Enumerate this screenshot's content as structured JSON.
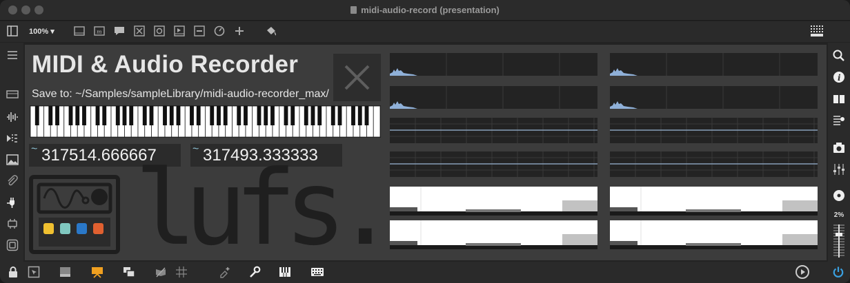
{
  "window": {
    "title": "midi-audio-record (presentation)"
  },
  "toolbar": {
    "zoom": "100%",
    "zoom_arrow": "▾"
  },
  "patch": {
    "title": "MIDI & Audio Recorder",
    "save_path": "Save to: ~/Samples/sampleLibrary/midi-audio-recorder_max/",
    "number_left": "317514.666667",
    "number_right": "317493.333333",
    "number_prefix": "~",
    "logo_text": "lufs."
  },
  "right_sidebar": {
    "cpu_label": "2%"
  },
  "colors": {
    "accent_orange": "#f0a020",
    "power_blue": "#3aa0e0",
    "scope_line": "#9ab8d8",
    "logo_yellow": "#f0c030",
    "logo_teal": "#80c8c0",
    "logo_blue": "#2a78c8",
    "logo_red": "#e06030"
  },
  "icons": {
    "toolbar": [
      "sidebar-toggle-icon",
      "panel-icon",
      "message-icon",
      "comment-icon",
      "toggle-icon",
      "button-icon",
      "play-icon",
      "slider-icon",
      "dial-icon",
      "add-icon",
      "paint-bucket-icon",
      "grid-icon"
    ],
    "left_sidebar": [
      "menu-icon",
      "device-icon",
      "audio-icon",
      "step-icon",
      "image-icon",
      "clip-icon",
      "plug-icon",
      "chip-icon",
      "frame-icon"
    ],
    "right_sidebar": [
      "search-icon",
      "info-icon",
      "book-icon",
      "list-icon",
      "camera-icon",
      "mixer-icon",
      "cd-icon",
      "cpu-meter-icon"
    ],
    "bottom": [
      "lock-icon",
      "presentation-mode-icon",
      "patcher-icon",
      "display-icon",
      "windows-icon",
      "snap-icon",
      "grid-icon",
      "debug-icon",
      "wrench-icon",
      "piano-icon",
      "keyboard-icon",
      "transport-icon",
      "power-icon"
    ]
  }
}
